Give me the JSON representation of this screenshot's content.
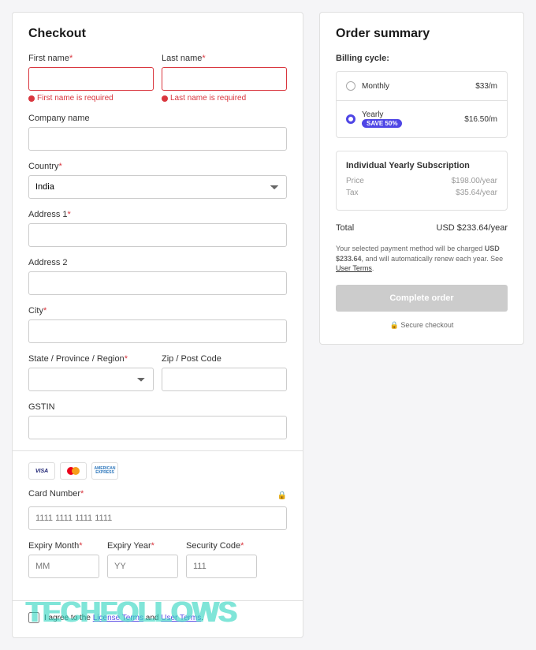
{
  "checkout": {
    "title": "Checkout",
    "first_name_label": "First name",
    "last_name_label": "Last name",
    "first_name_err": "First name is required",
    "last_name_err": "Last name is required",
    "company_label": "Company name",
    "country_label": "Country",
    "country_value": "India",
    "address1_label": "Address 1",
    "address2_label": "Address 2",
    "city_label": "City",
    "state_label": "State / Province / Region",
    "zip_label": "Zip / Post Code",
    "gstin_label": "GSTIN",
    "card_number_label": "Card Number",
    "card_number_ph": "1111 1111 1111 1111",
    "expiry_month_label": "Expiry Month",
    "expiry_month_ph": "MM",
    "expiry_year_label": "Expiry Year",
    "expiry_year_ph": "YY",
    "security_label": "Security Code",
    "security_ph": "111",
    "agree_prefix": "I agree to the ",
    "license_terms": "License Terms",
    "and": " and ",
    "user_terms": "User Terms",
    "period": "."
  },
  "summary": {
    "title": "Order summary",
    "billing_cycle_label": "Billing cycle:",
    "monthly_label": "Monthly",
    "monthly_price": "$33/m",
    "yearly_label": "Yearly",
    "yearly_price": "$16.50/m",
    "save_badge": "SAVE 50%",
    "sub_title": "Individual Yearly Subscription",
    "price_label": "Price",
    "price_value": "$198.00/year",
    "tax_label": "Tax",
    "tax_value": "$35.64/year",
    "total_label": "Total",
    "total_value": "USD $233.64/year",
    "fine_1": "Your selected payment method will be charged ",
    "fine_bold": "USD $233.64",
    "fine_2": ", and will automatically renew each year. See ",
    "fine_link": "User Terms",
    "fine_3": ".",
    "complete": "Complete order",
    "secure": "Secure checkout"
  },
  "watermark": "TECHFOLLOWS"
}
